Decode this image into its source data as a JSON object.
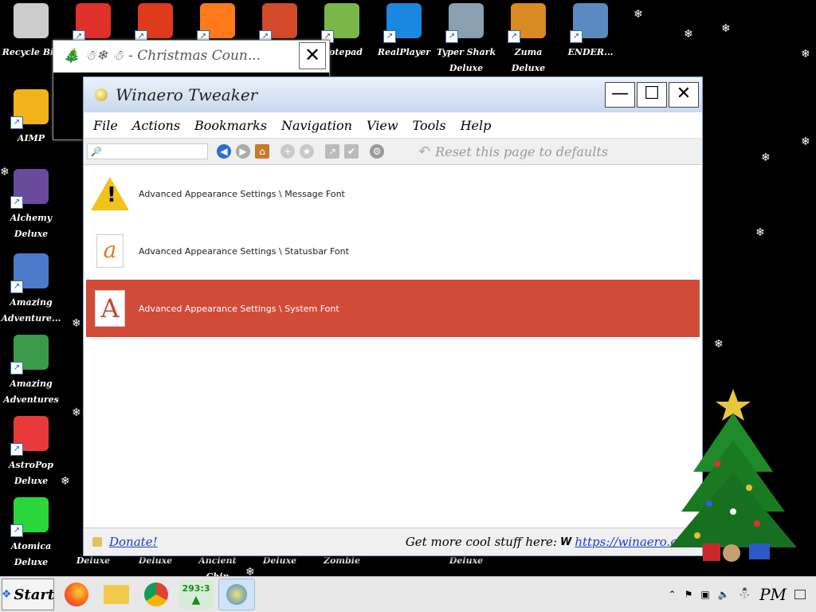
{
  "desktop": {
    "icons": [
      {
        "label": "Recycle Bin",
        "color": "#cccccc"
      },
      {
        "label": "",
        "color": "#e0302a"
      },
      {
        "label": "",
        "color": "#e03a1c"
      },
      {
        "label": "",
        "color": "#ff7a1a"
      },
      {
        "label": "",
        "color": "#d24a2a"
      },
      {
        "label": "Notepad",
        "color": "#7ab648"
      },
      {
        "label": "RealPlayer",
        "color": "#1a87e0"
      },
      {
        "label": "Typer Shark Deluxe",
        "color": "#8aa0b0"
      },
      {
        "label": "Zuma Deluxe",
        "color": "#d98a22"
      },
      {
        "label": "ENDER...",
        "color": "#5a8abf"
      },
      {
        "label": "AIMP",
        "color": "#f2b21a"
      },
      {
        "label": "Alchemy Deluxe",
        "color": "#6a4a9a"
      },
      {
        "label": "Amazing Adventure...",
        "color": "#4a7ac9"
      },
      {
        "label": "Amazing Adventures ...",
        "color": "#3a9a4a"
      },
      {
        "label": "AstroPop Deluxe",
        "color": "#e83a3a"
      },
      {
        "label": "Atomica Deluxe",
        "color": "#2ad63a"
      }
    ],
    "bottom_labels": [
      "Deluxe",
      "Deluxe",
      "Ancient Chin",
      "Deluxe",
      "Zombie",
      "Deluxe"
    ]
  },
  "back_window": {
    "title": "🎄 ☃❄ ☃ - Christmas Coun...",
    "close": "✕"
  },
  "window": {
    "title": "Winaero Tweaker",
    "minimize": "—",
    "maximize": "☐",
    "close": "✕",
    "menu": [
      "File",
      "Actions",
      "Bookmarks",
      "Navigation",
      "View",
      "Tools",
      "Help"
    ],
    "search": {
      "value": "🔎",
      "placeholder": ""
    },
    "reset_label": "Reset this page to defaults",
    "items": [
      {
        "label": "Advanced Appearance Settings \\ Message Font",
        "icon": "warning-icon"
      },
      {
        "label": "Advanced Appearance Settings \\ Statusbar Font",
        "icon": "font-a-icon"
      },
      {
        "label": "Advanced Appearance Settings \\ System Font",
        "icon": "font-A-icon"
      }
    ],
    "selected_index": 2,
    "selection_color": "#d14b39",
    "status": {
      "donate": "Donate!",
      "more": "Get more cool stuff here:",
      "w": "W",
      "url": "https://winaero.com"
    }
  },
  "taskbar": {
    "start": "Start",
    "counter": "293:3",
    "clock": "PM"
  }
}
